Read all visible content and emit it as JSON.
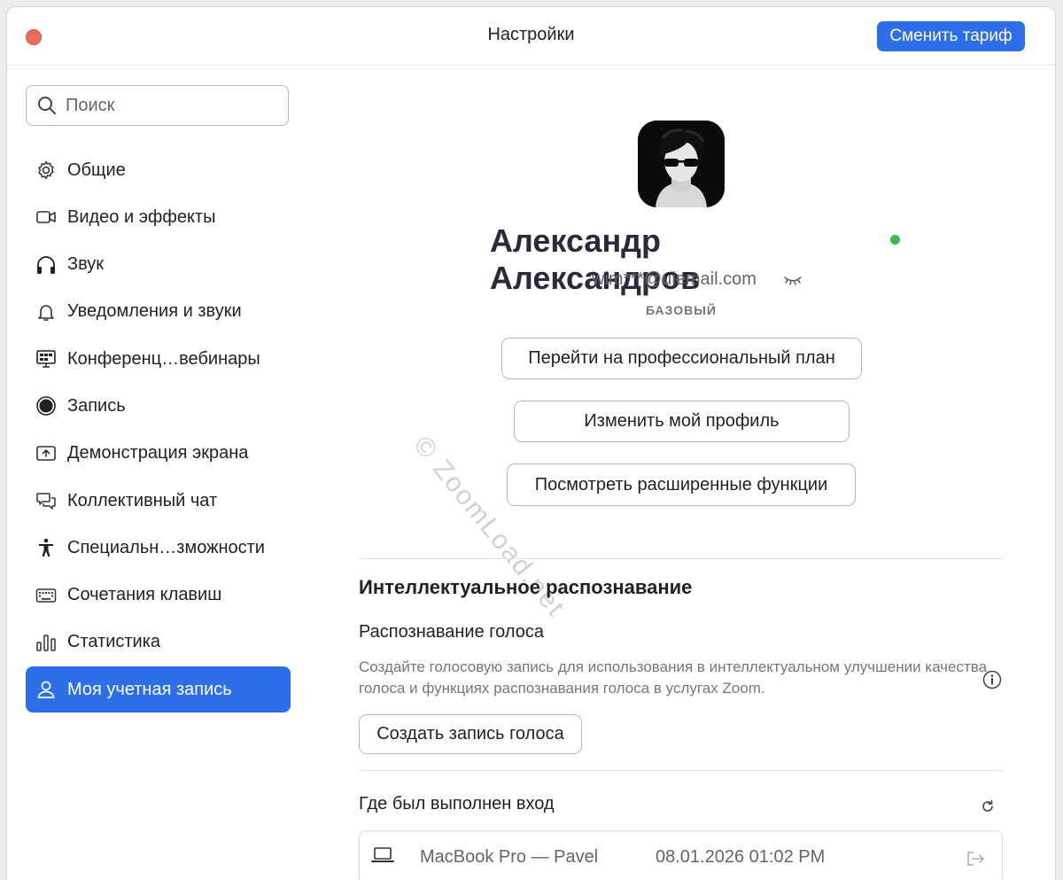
{
  "window": {
    "title": "Настройки",
    "upgrade_label": "Сменить тариф"
  },
  "search": {
    "placeholder": "Поиск"
  },
  "sidebar": {
    "items": [
      {
        "label": "Общие",
        "icon": "gear-icon"
      },
      {
        "label": "Видео и эффекты",
        "icon": "video-camera-icon"
      },
      {
        "label": "Звук",
        "icon": "headphones-icon"
      },
      {
        "label": "Уведомления и звуки",
        "icon": "bell-icon"
      },
      {
        "label": "Конференц…вебинары",
        "icon": "conference-icon"
      },
      {
        "label": "Запись",
        "icon": "record-icon"
      },
      {
        "label": "Демонстрация экрана",
        "icon": "share-screen-icon"
      },
      {
        "label": "Коллективный чат",
        "icon": "chat-icon"
      },
      {
        "label": "Специальн…зможности",
        "icon": "accessibility-icon"
      },
      {
        "label": "Сочетания клавиш",
        "icon": "keyboard-icon"
      },
      {
        "label": "Статистика",
        "icon": "bar-chart-icon"
      },
      {
        "label": "Моя учетная запись",
        "icon": "person-icon",
        "active": true
      }
    ]
  },
  "profile": {
    "name": "Александр Александров",
    "email": "wim***@uiemail.com",
    "plan": "БАЗОВЫЙ",
    "buttons": {
      "upgrade_pro": "Перейти на профессиональный план",
      "edit_profile": "Изменить мой профиль",
      "advanced": "Посмотреть расширенные функции"
    }
  },
  "watermark": "© ZoomLoad.net",
  "smart_recognition": {
    "title": "Интеллектуальное распознавание",
    "voice_title": "Распознавание голоса",
    "description": "Создайте голосовую запись для использования в интеллектуальном улучшении качества голоса и функциях распознавания голоса в услугах Zoom.",
    "create_button": "Создать запись голоса"
  },
  "sign_in": {
    "title": "Где был выполнен вход",
    "devices": [
      {
        "name": "MacBook Pro — Pavel",
        "time": "08.01.2026 01:02 PM"
      }
    ]
  },
  "colors": {
    "accent": "#2d6fe8",
    "online": "#3dba4e",
    "close": "#ec6a5e"
  }
}
